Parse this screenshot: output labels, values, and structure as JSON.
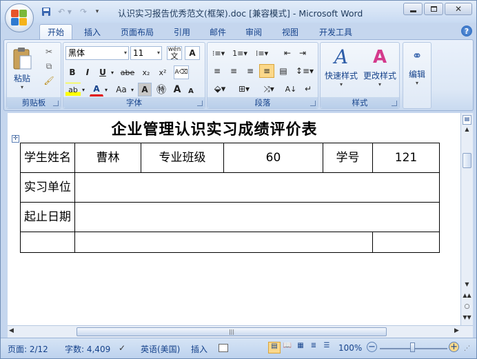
{
  "window": {
    "title": "认识实习报告优秀范文(框架).doc [兼容模式] - Microsoft Word",
    "buttons": {
      "minimize": "▭",
      "restore": "▢",
      "close": "✕"
    }
  },
  "tabs": [
    "开始",
    "插入",
    "页面布局",
    "引用",
    "邮件",
    "审阅",
    "视图",
    "开发工具"
  ],
  "active_tab": "开始",
  "ribbon": {
    "clipboard": {
      "label": "剪贴板",
      "paste": "粘贴"
    },
    "font": {
      "label": "字体",
      "font_name": "黑体",
      "font_size": "11",
      "phonetic": "wén",
      "bold": "B",
      "italic": "I",
      "underline": "U",
      "strike": "abe",
      "subscript": "x₂",
      "superscript": "x²",
      "case": "Aa",
      "grow": "A",
      "shrink": "A"
    },
    "paragraph": {
      "label": "段落"
    },
    "styles": {
      "label": "样式",
      "quick": "快速样式",
      "change": "更改样式"
    },
    "editing": {
      "label": "编辑"
    }
  },
  "document": {
    "title": "企业管理认识实习成绩评价表",
    "rows": [
      [
        "学生姓名",
        "曹林",
        "专业班级",
        "60",
        "学号",
        "121"
      ],
      [
        "实习单位",
        ""
      ],
      [
        "起止日期",
        ""
      ]
    ]
  },
  "status": {
    "page": "页面: 2/12",
    "words": "字数: 4,409",
    "language": "英语(美国)",
    "mode": "插入",
    "zoom": "100%"
  },
  "colors": {
    "accent": "#15428b",
    "ribbon_bg": "#dfe9f6",
    "highlight": "#ffff00",
    "font_color": "#e00000"
  }
}
